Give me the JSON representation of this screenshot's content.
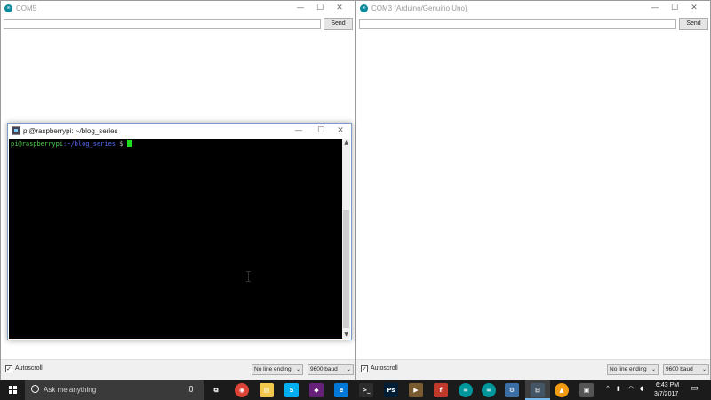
{
  "left_monitor": {
    "title": "COM5",
    "send_label": "Send",
    "autoscroll_label": "Autoscroll",
    "autoscroll_checked": true,
    "line_ending": "No line ending",
    "baud": "9600 baud"
  },
  "right_monitor": {
    "title": "COM3 (Arduino/Genuino Uno)",
    "send_label": "Send",
    "autoscroll_label": "Autoscroll",
    "autoscroll_checked": true,
    "line_ending": "No line ending",
    "baud": "9600 baud"
  },
  "window_buttons": {
    "minimize": "—",
    "maximize": "☐",
    "close": "✕"
  },
  "arduino_icon_text": "∞",
  "checkmark": "✓",
  "chevron": "⌄",
  "putty": {
    "title": "pi@raspberrypi: ~/blog_series",
    "prompt_user": "pi@raspberrypi",
    "prompt_path": ":~/blog_series",
    "prompt_symbol": " $ ",
    "scroll_up": "▲",
    "scroll_down": "▼"
  },
  "taskbar": {
    "search_placeholder": "Ask me anything",
    "time": "6:43 PM",
    "date": "3/7/2017",
    "apps": [
      {
        "name": "task-view-icon",
        "label": "⧉",
        "color": "#1b1b1b"
      },
      {
        "name": "chrome-icon",
        "label": "◉",
        "color": "#db4437"
      },
      {
        "name": "file-explorer-icon",
        "label": "▤",
        "color": "#f2c94c"
      },
      {
        "name": "skype-icon",
        "label": "S",
        "color": "#00aff0"
      },
      {
        "name": "visual-studio-icon",
        "label": "◆",
        "color": "#68217a"
      },
      {
        "name": "edge-icon",
        "label": "e",
        "color": "#0078d7"
      },
      {
        "name": "terminal-icon",
        "label": ">_",
        "color": "#2d2d2d"
      },
      {
        "name": "photoshop-icon",
        "label": "Ps",
        "color": "#001e36"
      },
      {
        "name": "media-player-icon",
        "label": "▶",
        "color": "#7a5a2f"
      },
      {
        "name": "fritzing-icon",
        "label": "f",
        "color": "#c0392b"
      },
      {
        "name": "arduino-icon",
        "label": "∞",
        "color": "#00979c"
      },
      {
        "name": "arduino-icon",
        "label": "∞",
        "color": "#00979c"
      },
      {
        "name": "device-manager-icon",
        "label": "⚙",
        "color": "#3b6ea5"
      },
      {
        "name": "putty-icon",
        "label": "⊟",
        "color": "#445566"
      },
      {
        "name": "vlc-icon",
        "label": "▲",
        "color": "#f39c12"
      },
      {
        "name": "video-icon",
        "label": "▣",
        "color": "#555555"
      }
    ],
    "tray": {
      "chevron": "⌃",
      "network": "▮",
      "wifi": "◠",
      "volume": "◖",
      "notification": "▭"
    }
  },
  "colors": {
    "terminal_green": "#4fd34f",
    "terminal_blue": "#5a6cff",
    "taskbar_bg": "#1b1b1b",
    "arduino_teal": "#0e8b9c"
  }
}
